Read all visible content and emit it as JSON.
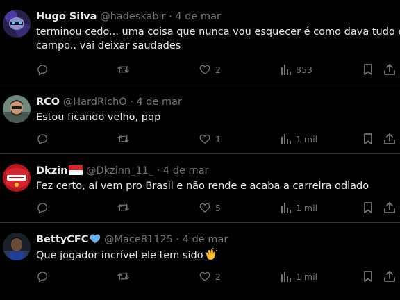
{
  "posts": [
    {
      "name": "Hugo Silva",
      "handle": "@hadeskabir",
      "separator": "·",
      "date": "4 de mar",
      "text_lines": [
        "terminou cedo... uma coisa que nunca vou esquecer é como dava tudo em",
        "campo.. vai deixar saudades"
      ],
      "likes": "2",
      "views": "853"
    },
    {
      "name": "RCO",
      "handle": "@HardRichO",
      "separator": "·",
      "date": "4 de mar",
      "text_lines": [
        "Estou ficando velho, pqp"
      ],
      "likes": "1",
      "views": "1 mil"
    },
    {
      "name": "Dkzin",
      "handle": "@Dkzinn_11_",
      "separator": "·",
      "date": "4 de mar",
      "text_lines": [
        "Fez certo, aí vem pro Brasil e não rende e acaba a carreira odiado"
      ],
      "likes": "5",
      "views": "1 mil"
    },
    {
      "name": "BettyCFC",
      "handle": "@Mace81125",
      "separator": "·",
      "date": "4 de mar",
      "text_lines": [
        "Que jogador incrível ele tem sido"
      ],
      "likes": "2",
      "views": "1 mil"
    }
  ],
  "icons": {
    "reply": "reply-icon",
    "repost": "repost-icon",
    "like": "like-icon",
    "views": "views-icon",
    "bookmark": "bookmark-icon",
    "share": "share-icon"
  },
  "colors": {
    "background": "#000000",
    "text": "#e7e9ea",
    "muted": "#71767b",
    "divider": "#2f3336",
    "heart_badge": "#6cb4ee",
    "flag_red": "#e0202a"
  }
}
